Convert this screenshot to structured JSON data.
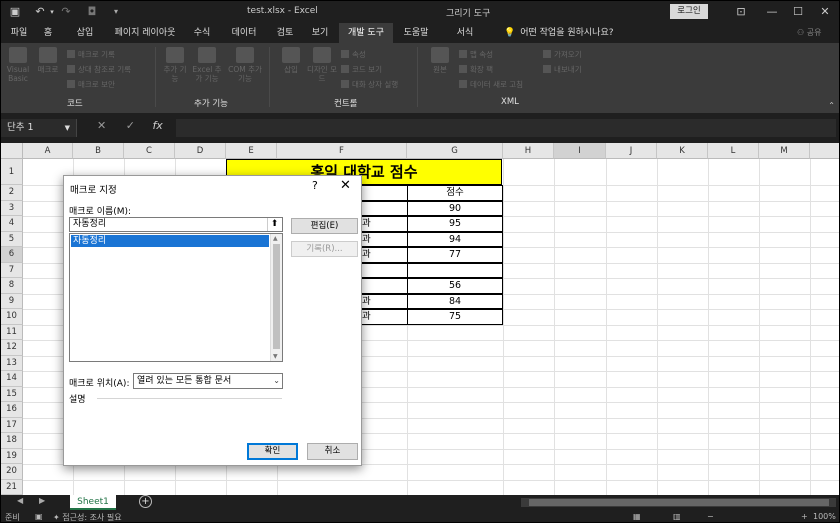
{
  "window": {
    "title": "test.xlsx - Excel",
    "context_tab": "그리기 도구",
    "login_label": "로그인"
  },
  "quick_access": [
    "save-icon",
    "undo-icon",
    "redo-icon",
    "camera-icon",
    "customize-icon"
  ],
  "tabs": [
    "파일",
    "홈",
    "삽입",
    "페이지 레이아웃",
    "수식",
    "데이터",
    "검토",
    "보기",
    "개발 도구",
    "도움말",
    "서식"
  ],
  "active_tab": "개발 도구",
  "tell_me": "어떤 작업을 원하시나요?",
  "share_label": "공유",
  "ribbon": {
    "groups": {
      "code": "코드",
      "addins": "추가 기능",
      "controls": "컨트롤",
      "xml": "XML"
    },
    "code": {
      "visual_basic": "Visual Basic",
      "macro": "매크로",
      "record": "매크로 기록",
      "relative": "상대 참조로 기록",
      "security": "매크로 보안"
    },
    "addins": {
      "addins": "추가 기능",
      "excel_addins": "Excel 추가 기능",
      "com_addins": "COM 추가 기능"
    },
    "controls": {
      "insert": "삽입",
      "design": "디자인 모드",
      "properties": "속성",
      "view_code": "코드 보기",
      "run_dialog": "대화 상자 실행"
    },
    "xml": {
      "source": "원본",
      "map_props": "맵 속성",
      "expansion": "확장 팩",
      "refresh": "데이터 새로 고침",
      "import": "가져오기",
      "export": "내보내기"
    }
  },
  "formula_bar": {
    "name_box": "단추 1",
    "fx": "fx",
    "content": ""
  },
  "grid": {
    "columns": [
      "A",
      "B",
      "C",
      "D",
      "E",
      "F",
      "G",
      "H",
      "I",
      "J",
      "K",
      "L",
      "M"
    ],
    "selected_column": "I",
    "rows": [
      "1",
      "2",
      "3",
      "4",
      "5",
      "6",
      "7",
      "8",
      "9",
      "10",
      "11",
      "12",
      "13",
      "14",
      "15",
      "16",
      "17",
      "18",
      "19",
      "20",
      "21"
    ],
    "selected_row": "6",
    "title_cell": "홍익 대학교 점수",
    "score_header": "점수",
    "f_column_visible": [
      "",
      "",
      "과",
      "과",
      "과",
      "",
      "",
      "과",
      "과"
    ],
    "g_column_scores": [
      "90",
      "95",
      "94",
      "77",
      "",
      "56",
      "84",
      "75"
    ]
  },
  "sheet_tabs": [
    "Sheet1"
  ],
  "status_bar": {
    "ready": "준비",
    "accessibility": "접근성: 조사 필요",
    "zoom": "100%"
  },
  "dialog": {
    "title": "매크로 지정",
    "help": "?",
    "macro_name_label": "매크로 이름(M):",
    "macro_name_value": "자동정리",
    "macro_list": [
      "자동정리"
    ],
    "buttons": {
      "edit": "편집(E)",
      "record": "기록(R)...",
      "ok": "확인",
      "cancel": "취소"
    },
    "location_label": "매크로 위치(A):",
    "location_value": "열려 있는 모든 통합 문서",
    "description_label": "설명"
  }
}
